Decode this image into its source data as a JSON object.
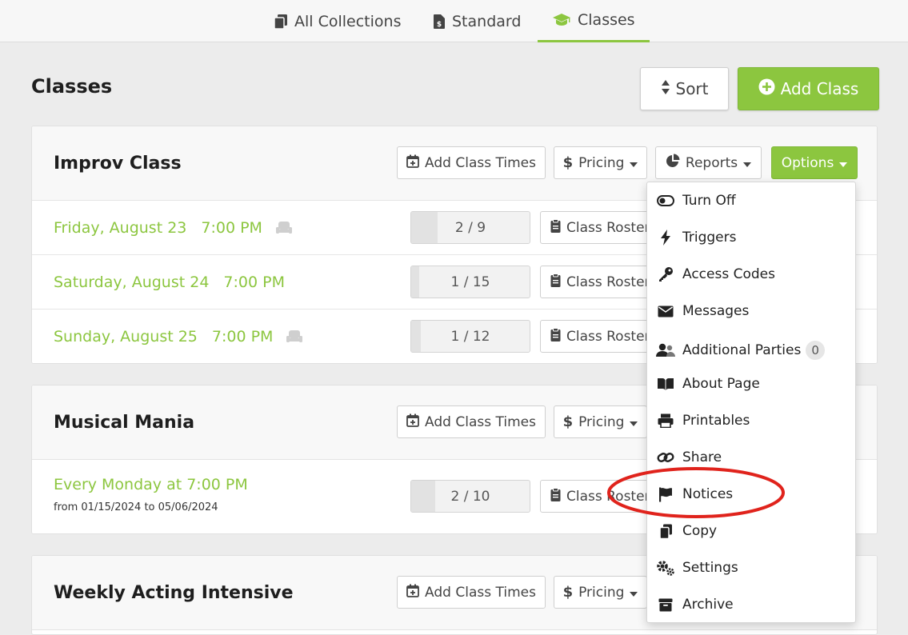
{
  "nav": {
    "tabs": [
      {
        "label": "All Collections",
        "icon": "copy-icon"
      },
      {
        "label": "Standard",
        "icon": "price-doc-icon"
      },
      {
        "label": "Classes",
        "icon": "graduation-cap-icon",
        "active": true
      }
    ]
  },
  "page": {
    "title": "Classes",
    "sort_label": "Sort",
    "add_class_label": "Add Class"
  },
  "colors": {
    "accent_green": "#8cc63f",
    "highlight_red": "#e0231c"
  },
  "header_buttons": {
    "add_times": "Add Class Times",
    "pricing": "Pricing",
    "reports": "Reports",
    "options": "Options"
  },
  "classes": [
    {
      "title": "Improv Class",
      "sessions": [
        {
          "date": "Friday, August 23",
          "time": "7:00 PM",
          "capacity": "2 / 9",
          "fill": 0.22,
          "seat_icon": true,
          "roster": "Class Roster"
        },
        {
          "date": "Saturday, August 24",
          "time": "7:00 PM",
          "capacity": "1 / 15",
          "fill": 0.07,
          "seat_icon": false,
          "roster": "Class Roster"
        },
        {
          "date": "Sunday, August 25",
          "time": "7:00 PM",
          "capacity": "1 / 12",
          "fill": 0.08,
          "seat_icon": true,
          "roster": "Class Roster"
        }
      ]
    },
    {
      "title": "Musical Mania",
      "recurring": {
        "label": "Every Monday at 7:00 PM",
        "range": "from 01/15/2024 to 05/06/2024",
        "capacity": "2 / 10",
        "fill": 0.2,
        "roster": "Class Roster"
      }
    },
    {
      "title": "Weekly Acting Intensive"
    }
  ],
  "options_menu": [
    {
      "label": "Turn Off",
      "icon": "toggle-icon"
    },
    {
      "label": "Triggers",
      "icon": "bolt-icon"
    },
    {
      "label": "Access Codes",
      "icon": "key-icon"
    },
    {
      "label": "Messages",
      "icon": "envelope-icon"
    },
    {
      "label": "Additional Parties",
      "icon": "users-icon",
      "badge": "0"
    },
    {
      "label": "About Page",
      "icon": "book-icon"
    },
    {
      "label": "Printables",
      "icon": "printer-icon"
    },
    {
      "label": "Share",
      "icon": "link-icon"
    },
    {
      "label": "Notices",
      "icon": "flag-icon",
      "highlighted": true
    },
    {
      "label": "Copy",
      "icon": "copy-icon"
    },
    {
      "label": "Settings",
      "icon": "cogs-icon"
    },
    {
      "label": "Archive",
      "icon": "archive-icon"
    }
  ]
}
